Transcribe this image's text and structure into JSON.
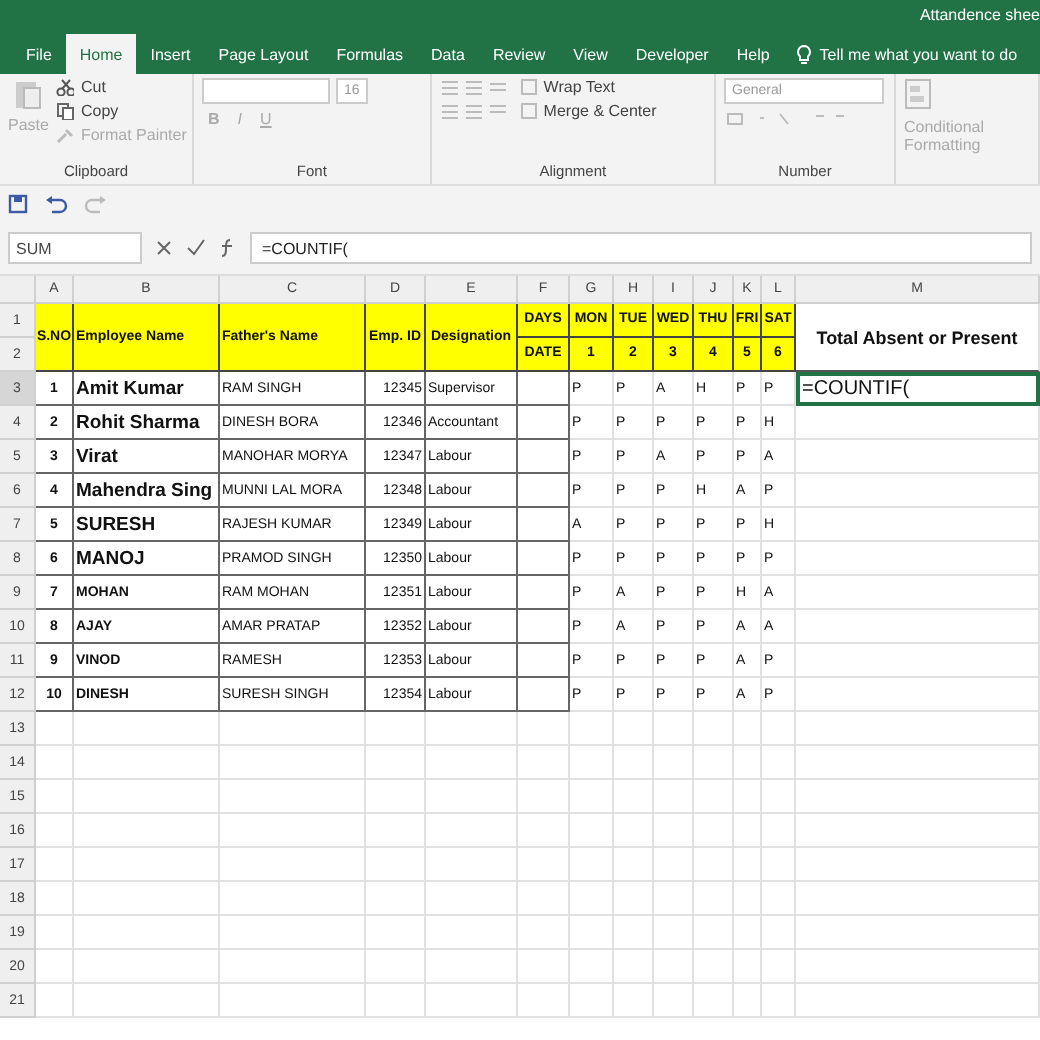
{
  "window": {
    "title": "Attandence shee"
  },
  "tabs": [
    {
      "label": "File",
      "selected": false
    },
    {
      "label": "Home",
      "selected": true
    },
    {
      "label": "Insert",
      "selected": false
    },
    {
      "label": "Page Layout",
      "selected": false
    },
    {
      "label": "Formulas",
      "selected": false
    },
    {
      "label": "Data",
      "selected": false
    },
    {
      "label": "Review",
      "selected": false
    },
    {
      "label": "View",
      "selected": false
    },
    {
      "label": "Developer",
      "selected": false
    },
    {
      "label": "Help",
      "selected": false
    }
  ],
  "tell_me": "Tell me what you want to do",
  "ribbon": {
    "clipboard": {
      "paste": "Paste",
      "cut": "Cut",
      "copy": "Copy",
      "format_painter": "Format Painter",
      "label": "Clipboard"
    },
    "font": {
      "size": "16",
      "styles": [
        "B",
        "I",
        "U"
      ],
      "label": "Font"
    },
    "alignment": {
      "wrap_text": "Wrap Text",
      "merge_center": "Merge & Center",
      "label": "Alignment"
    },
    "number": {
      "format": "General",
      "label": "Number"
    },
    "conditional": "Conditional Formatting"
  },
  "formula_bar": {
    "name_box": "SUM",
    "formula": "=COUNTIF("
  },
  "sheet": {
    "columns": [
      "A",
      "B",
      "C",
      "D",
      "E",
      "F",
      "G",
      "H",
      "I",
      "J",
      "K",
      "L",
      "M"
    ],
    "row_numbers": [
      "1",
      "2",
      "3",
      "4",
      "5",
      "6",
      "7",
      "8",
      "9",
      "10",
      "11",
      "12",
      "13",
      "14",
      "15",
      "16",
      "17",
      "18",
      "19",
      "20",
      "21"
    ],
    "header": {
      "sno": "S.NO",
      "employee": "Employee Name",
      "father": "Father's Name",
      "emp_id": "Emp. ID",
      "designation": "Designation",
      "days": "DAYS",
      "date": "DATE",
      "weekdays": [
        "MON",
        "TUE",
        "WED",
        "THU",
        "FRI",
        "SAT"
      ],
      "dates": [
        "1",
        "2",
        "3",
        "4",
        "5",
        "6"
      ],
      "total": "Total Absent or Present"
    },
    "rows": [
      {
        "sno": "1",
        "name": "Amit Kumar",
        "kind": "large",
        "father": "RAM SINGH",
        "emp_id": "12345",
        "designation": "Supervisor",
        "attendance": [
          "P",
          "P",
          "A",
          "H",
          "P",
          "P"
        ]
      },
      {
        "sno": "2",
        "name": "Rohit Sharma",
        "kind": "large",
        "father": "DINESH BORA",
        "emp_id": "12346",
        "designation": "Accountant",
        "attendance": [
          "P",
          "P",
          "P",
          "P",
          "P",
          "H"
        ]
      },
      {
        "sno": "3",
        "name": "Virat",
        "kind": "large",
        "father": "MANOHAR MORYA",
        "emp_id": "12347",
        "designation": "Labour",
        "attendance": [
          "P",
          "P",
          "A",
          "P",
          "P",
          "A"
        ]
      },
      {
        "sno": "4",
        "name": "Mahendra Sing",
        "kind": "large",
        "father": "MUNNI LAL MORA",
        "emp_id": "12348",
        "designation": "Labour",
        "attendance": [
          "P",
          "P",
          "P",
          "H",
          "A",
          "P"
        ]
      },
      {
        "sno": "5",
        "name": "SURESH",
        "kind": "large",
        "father": "RAJESH KUMAR",
        "emp_id": "12349",
        "designation": "Labour",
        "attendance": [
          "A",
          "P",
          "P",
          "P",
          "P",
          "H"
        ]
      },
      {
        "sno": "6",
        "name": "MANOJ",
        "kind": "large",
        "father": "PRAMOD SINGH",
        "emp_id": "12350",
        "designation": "Labour",
        "attendance": [
          "P",
          "P",
          "P",
          "P",
          "P",
          "P"
        ]
      },
      {
        "sno": "7",
        "name": "MOHAN",
        "kind": "small",
        "father": "RAM MOHAN",
        "emp_id": "12351",
        "designation": "Labour",
        "attendance": [
          "P",
          "A",
          "P",
          "P",
          "H",
          "A"
        ]
      },
      {
        "sno": "8",
        "name": "AJAY",
        "kind": "small",
        "father": "AMAR PRATAP",
        "emp_id": "12352",
        "designation": "Labour",
        "attendance": [
          "P",
          "A",
          "P",
          "P",
          "A",
          "A"
        ]
      },
      {
        "sno": "9",
        "name": "VINOD",
        "kind": "small",
        "father": "RAMESH",
        "emp_id": "12353",
        "designation": "Labour",
        "attendance": [
          "P",
          "P",
          "P",
          "P",
          "A",
          "P"
        ]
      },
      {
        "sno": "10",
        "name": "DINESH",
        "kind": "small",
        "father": "SURESH SINGH",
        "emp_id": "12354",
        "designation": "Labour",
        "attendance": [
          "P",
          "P",
          "P",
          "P",
          "A",
          "P"
        ]
      }
    ],
    "active_cell": "=COUNTIF("
  }
}
